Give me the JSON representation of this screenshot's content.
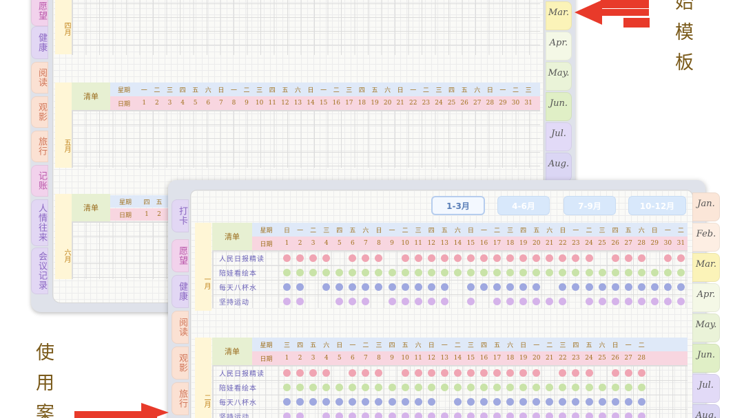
{
  "back_sheet": {
    "left_tabs": [
      {
        "label": "愿望",
        "color": "#f2d2ec",
        "text": "#b857a9"
      },
      {
        "label": "健康",
        "color": "#e2d7f4",
        "text": "#8a67c2"
      },
      {
        "label": "阅读",
        "color": "#fbe1d3",
        "text": "#d0775b"
      },
      {
        "label": "观影",
        "color": "#fbe1d3",
        "text": "#d0775b"
      },
      {
        "label": "旅行",
        "color": "#fbe1d3",
        "text": "#d0775b"
      },
      {
        "label": "记账",
        "color": "#f2d2ec",
        "text": "#b857a9"
      },
      {
        "label": "人情往来",
        "color": "#e2d7f4",
        "text": "#8a67c2"
      },
      {
        "label": "会议记录",
        "color": "#e2d7f4",
        "text": "#8a67c2"
      }
    ],
    "right_tabs": [
      {
        "label": "Mar.",
        "color": "#fbf3b8"
      },
      {
        "label": "Apr.",
        "color": "#f4f8e6"
      },
      {
        "label": "May.",
        "color": "#eaf3d8"
      },
      {
        "label": "Jun.",
        "color": "#e0efc6"
      },
      {
        "label": "Jul.",
        "color": "#e2daf7"
      },
      {
        "label": "Aug.",
        "color": "#dbd6f4"
      }
    ],
    "months": [
      {
        "label": "四月"
      },
      {
        "label": "五月",
        "qingdan": "清单",
        "weekday_label": "星期",
        "date_label": "日期",
        "weekdays": [
          "一",
          "二",
          "三",
          "四",
          "五",
          "六",
          "日",
          "一",
          "二",
          "三",
          "四",
          "五",
          "六",
          "日",
          "一",
          "二",
          "三",
          "四",
          "五",
          "六",
          "日",
          "一",
          "二",
          "三",
          "四",
          "五",
          "六",
          "日",
          "一",
          "二",
          "三"
        ],
        "dates": [
          "1",
          "2",
          "3",
          "4",
          "5",
          "6",
          "7",
          "8",
          "9",
          "10",
          "11",
          "12",
          "13",
          "14",
          "15",
          "16",
          "17",
          "18",
          "19",
          "20",
          "21",
          "22",
          "23",
          "24",
          "25",
          "26",
          "27",
          "28",
          "29",
          "30",
          "31"
        ]
      },
      {
        "label": "六月",
        "qingdan": "清单",
        "weekday_label": "星期",
        "date_label": "日期",
        "weekdays": [
          "四",
          "五"
        ],
        "dates": [
          "1",
          "2"
        ]
      }
    ]
  },
  "front_sheet": {
    "quarter_buttons": [
      {
        "label": "1-3月",
        "active": true
      },
      {
        "label": "4-6月",
        "active": false
      },
      {
        "label": "7-9月",
        "active": false
      },
      {
        "label": "10-12月",
        "active": false
      }
    ],
    "left_tabs": [
      {
        "label": "打卡",
        "color": "#e2d7f4",
        "text": "#8a67c2"
      },
      {
        "label": "愿望",
        "color": "#f2d2ec",
        "text": "#b857a9"
      },
      {
        "label": "健康",
        "color": "#e2d7f4",
        "text": "#8a67c2"
      },
      {
        "label": "阅读",
        "color": "#fbe1d3",
        "text": "#d0775b"
      },
      {
        "label": "观影",
        "color": "#fbe1d3",
        "text": "#d0775b"
      },
      {
        "label": "旅行",
        "color": "#fbe1d3",
        "text": "#d0775b"
      }
    ],
    "right_tabs": [
      {
        "label": "Jan.",
        "color": "#fbe6d8"
      },
      {
        "label": "Feb.",
        "color": "#fdeee3"
      },
      {
        "label": "Mar.",
        "color": "#fbf3b8"
      },
      {
        "label": "Apr.",
        "color": "#f4f8e6"
      },
      {
        "label": "May.",
        "color": "#eaf3d8"
      },
      {
        "label": "Jun.",
        "color": "#e0efc6"
      },
      {
        "label": "Jul.",
        "color": "#e2daf7"
      },
      {
        "label": "Aug.",
        "color": "#dbd6f4"
      }
    ],
    "months": [
      {
        "label": "一月",
        "qingdan": "清单",
        "weekday_label": "星期",
        "date_label": "日期",
        "weekdays": [
          "日",
          "一",
          "二",
          "三",
          "四",
          "五",
          "六",
          "日",
          "一",
          "二",
          "三",
          "四",
          "五",
          "六",
          "日",
          "一",
          "二",
          "三",
          "四",
          "五",
          "六",
          "日",
          "一",
          "二",
          "三",
          "四",
          "五",
          "六",
          "日",
          "一",
          "二"
        ],
        "dates": [
          "1",
          "2",
          "3",
          "4",
          "5",
          "6",
          "7",
          "8",
          "9",
          "10",
          "11",
          "12",
          "13",
          "14",
          "15",
          "16",
          "17",
          "18",
          "19",
          "20",
          "21",
          "22",
          "23",
          "24",
          "25",
          "26",
          "27",
          "28",
          "29",
          "30",
          "31"
        ],
        "habits": [
          "人民日报精读",
          "陪娃看绘本",
          "每天八杯水",
          "坚持运动"
        ],
        "done": [
          [
            1,
            1,
            1,
            1,
            0,
            1,
            1,
            1,
            0,
            1,
            1,
            1,
            1,
            1,
            1,
            1,
            1,
            1,
            1,
            1,
            1,
            1,
            1,
            1,
            0,
            1,
            1,
            1,
            0,
            1,
            1
          ],
          [
            1,
            1,
            1,
            1,
            1,
            1,
            1,
            1,
            1,
            1,
            1,
            1,
            1,
            1,
            1,
            1,
            1,
            1,
            1,
            1,
            1,
            1,
            1,
            1,
            1,
            1,
            1,
            1,
            1,
            1,
            1
          ],
          [
            1,
            1,
            0,
            1,
            1,
            1,
            1,
            1,
            1,
            1,
            1,
            1,
            1,
            0,
            1,
            1,
            1,
            1,
            1,
            1,
            0,
            1,
            1,
            1,
            1,
            1,
            1,
            1,
            1,
            1,
            1
          ],
          [
            1,
            1,
            0,
            0,
            1,
            1,
            1,
            0,
            1,
            1,
            1,
            1,
            1,
            0,
            1,
            0,
            1,
            1,
            1,
            1,
            1,
            1,
            0,
            1,
            1,
            1,
            1,
            1,
            1,
            1,
            1
          ]
        ]
      },
      {
        "label": "二月",
        "qingdan": "清单",
        "weekday_label": "星期",
        "date_label": "日期",
        "weekdays": [
          "三",
          "四",
          "五",
          "六",
          "日",
          "一",
          "二",
          "三",
          "四",
          "五",
          "六",
          "日",
          "一",
          "二",
          "三",
          "四",
          "五",
          "六",
          "日",
          "一",
          "二",
          "三",
          "四",
          "五",
          "六",
          "日",
          "一",
          "二"
        ],
        "dates": [
          "1",
          "2",
          "3",
          "4",
          "5",
          "6",
          "7",
          "8",
          "9",
          "10",
          "11",
          "12",
          "13",
          "14",
          "15",
          "16",
          "17",
          "18",
          "19",
          "20",
          "21",
          "22",
          "23",
          "24",
          "25",
          "26",
          "27",
          "28"
        ],
        "habits": [
          "人民日报精读",
          "陪娃看绘本",
          "每天八杯水",
          "坚持运动"
        ],
        "done": [
          [
            1,
            1,
            1,
            1,
            0,
            1,
            1,
            1,
            0,
            1,
            1,
            1,
            1,
            1,
            1,
            1,
            1,
            1,
            1,
            1,
            0,
            1,
            1,
            1,
            0,
            1,
            1,
            1
          ],
          [
            1,
            1,
            1,
            1,
            1,
            1,
            1,
            1,
            1,
            1,
            1,
            1,
            1,
            1,
            1,
            1,
            1,
            1,
            1,
            1,
            1,
            1,
            1,
            1,
            1,
            1,
            1,
            1
          ],
          [
            1,
            1,
            1,
            1,
            1,
            1,
            1,
            1,
            1,
            1,
            1,
            1,
            0,
            1,
            1,
            1,
            1,
            1,
            1,
            1,
            1,
            1,
            1,
            1,
            1,
            1,
            1,
            1
          ],
          [
            1,
            1,
            0,
            1,
            1,
            1,
            1,
            1,
            1,
            1,
            1,
            1,
            1,
            1,
            1,
            1,
            1,
            1,
            1,
            1,
            1,
            1,
            1,
            1,
            1,
            1,
            1,
            1
          ]
        ]
      }
    ],
    "habit_colors": [
      "#f0a5b3",
      "#c9e3a8",
      "#9fa8e0",
      "#d5b3ea"
    ]
  },
  "annotations": {
    "top_right": "始模板",
    "bottom_left": "使用案",
    "arrow_color": "#e83a2a"
  }
}
